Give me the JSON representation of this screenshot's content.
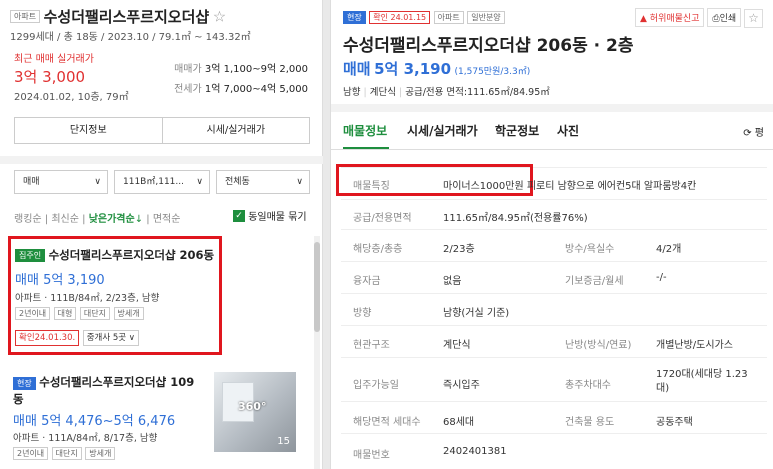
{
  "left": {
    "complex": {
      "badge": "아파트",
      "name": "수성더팰리스푸르지오더샵",
      "info": "1299세대 / 총 18동 / 2023.10 / 79.1㎡ ~ 143.32㎡",
      "recent_label": "최근 매매 실거래가",
      "recent_price": "3억 3,000",
      "recent_date": "2024.01.02, 10층, 79㎡",
      "sale_label": "매매가",
      "sale_range": "3억 1,100~9억 2,000",
      "jeonse_label": "전세가",
      "jeonse_range": "1억 7,000~4억 5,000"
    },
    "tabs": {
      "info": "단지정보",
      "market": "시세/실거래가"
    },
    "filters": {
      "type": "매매",
      "area": "111B㎡,111...",
      "dong": "전체동"
    },
    "sort": {
      "ranking": "랭킹순",
      "latest": "최신순",
      "low_price": "낮은가격순",
      "area": "면적순",
      "same_listing": "동일매물 묶기"
    },
    "listings": [
      {
        "badge": "집주인",
        "title": "수성더팰리스푸르지오더샵 206동",
        "price_label": "매매",
        "price": "5억 3,190",
        "spec": "아파트 · 111B/84㎡, 2/23층, 남향",
        "tags": [
          "2년이내",
          "대형",
          "대단지",
          "방세개"
        ],
        "confirm": "확인24.01.30.",
        "agents": "중개사 5곳"
      },
      {
        "badge": "현장",
        "title": "수성더팰리스푸르지오더샵 109동",
        "price_label": "매매",
        "price": "5억 4,476~5억 6,476",
        "spec": "아파트 · 111A/84㎡, 8/17층, 남향",
        "tags": [
          "2년이내",
          "대단지",
          "방세개"
        ],
        "photo_badge": "360°",
        "photo_count": "15"
      }
    ]
  },
  "right": {
    "header": {
      "tag_site": "현장",
      "tag_confirm": "확인 24.01.15",
      "tag_type": "아파트",
      "tag_sale": "일반분양",
      "report": "허위매물신고",
      "print": "인쇄",
      "title": "수성더팰리스푸르지오더샵 206동 · 2층",
      "price_label": "매매",
      "price": "5억 3,190",
      "unit_price": "(1,575만원/3.3㎡)",
      "specs": [
        "남향",
        "계단식",
        "공급/전용 면적:111.65㎡/84.95㎡"
      ]
    },
    "tabs": [
      "매물정보",
      "시세/실거래가",
      "학군정보",
      "사진"
    ],
    "tab_right": "평",
    "details": {
      "feature_label": "매물특징",
      "feature_value": "마이너스1000만원 피로티 남향으로 에어컨5대 알파룸방4칸",
      "area_label": "공급/전용면적",
      "area_value": "111.65㎡/84.95㎡(전용률76%)",
      "floor_label": "해당층/총층",
      "floor_value": "2/23층",
      "rooms_label": "방수/욕실수",
      "rooms_value": "4/2개",
      "loan_label": "융자금",
      "loan_value": "없음",
      "deposit_label": "기보증금/월세",
      "deposit_value": "-/-",
      "direction_label": "방향",
      "direction_value": "남향(거실 기준)",
      "entrance_label": "현관구조",
      "entrance_value": "계단식",
      "heating_label": "난방(방식/연료)",
      "heating_value": "개별난방/도시가스",
      "movein_label": "입주가능일",
      "movein_value": "즉시입주",
      "parking_label": "총주차대수",
      "parking_value": "1720대(세대당 1.23대)",
      "households_label": "해당면적 세대수",
      "households_value": "68세대",
      "use_label": "건축물 용도",
      "use_value": "공동주택",
      "listing_no_label": "매물번호",
      "listing_no_value": "2402401381"
    }
  },
  "colors": {
    "accent": "#2f6fd6",
    "highlight": "#e03131",
    "checkbox": "#1e8e3e"
  }
}
